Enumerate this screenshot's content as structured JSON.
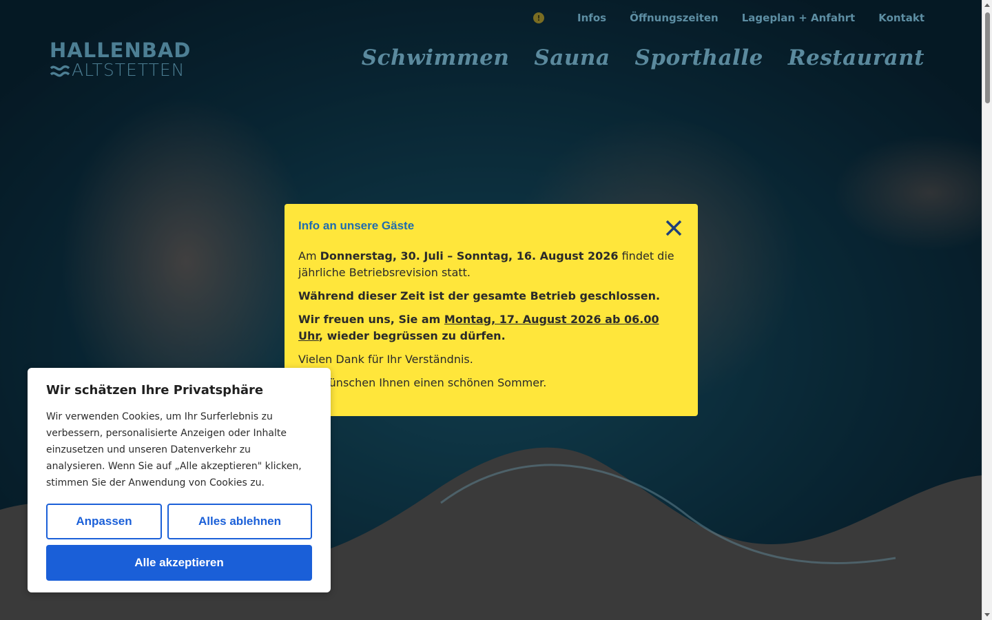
{
  "logo": {
    "line1": "HALLENBAD",
    "line2": "ALTSTETTEN"
  },
  "top_nav": {
    "alert_icon_glyph": "!",
    "items": [
      "Infos",
      "Öffnungszeiten",
      "Lageplan + Anfahrt",
      "Kontakt"
    ]
  },
  "main_nav": {
    "items": [
      "Schwimmen",
      "Sauna",
      "Sporthalle",
      "Restaurant"
    ]
  },
  "info_modal": {
    "title": "Info an unsere Gäste",
    "p1_prefix": "Am ",
    "p1_bold": "Donnerstag, 30. Juli – Sonntag, 16. August 2026",
    "p1_suffix": " findet die jährliche Betriebsrevision statt.",
    "p2": "Während dieser Zeit ist der gesamte Betrieb geschlossen.",
    "p3_prefix": "Wir freuen uns, Sie am ",
    "p3_link": "Montag, 17. August 2026 ab 06.00 Uhr",
    "p3_suffix": ", wieder begrüssen zu dürfen.",
    "p4": " Vielen Dank für Ihr Verständnis.",
    "p5": "Wir wünschen Ihnen einen schönen Sommer."
  },
  "cookie": {
    "title": "Wir schätzen Ihre Privatsphäre",
    "text": "Wir verwenden Cookies, um Ihr Surferlebnis zu verbessern, personalisierte Anzeigen oder Inhalte einzusetzen und unseren Datenverkehr zu analysieren. Wenn Sie auf „Alle akzeptieren\" klicken, stimmen Sie der Anwendung von Cookies zu.",
    "customize_label": "Anpassen",
    "reject_label": "Alles ablehnen",
    "accept_label": "Alle akzeptieren"
  },
  "colors": {
    "modal_bg": "#ffe63b",
    "modal_title": "#1f6cb0",
    "button_blue": "#1a5fd8",
    "nav_text": "#5d8ea3"
  }
}
